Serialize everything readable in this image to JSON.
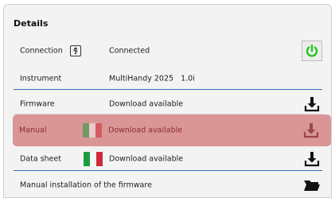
{
  "panel": {
    "title": "Details"
  },
  "connection": {
    "label": "Connection",
    "value": "Connected",
    "icon": "usb-icon",
    "action_icon": "power-icon",
    "action_color": "#22c41f"
  },
  "instrument": {
    "label": "Instrument",
    "value": "MultiHandy 2025",
    "version": "1.0i"
  },
  "firmware": {
    "label": "Firmware",
    "value": "Download available",
    "action_icon": "download-icon"
  },
  "manual": {
    "label": "Manual",
    "value": "Download available",
    "flag": "italy-flag",
    "highlight_color": "#c44848",
    "action_icon": "download-icon"
  },
  "datasheet": {
    "label": "Data sheet",
    "value": "Download available",
    "flag": "italy-flag",
    "action_icon": "download-icon"
  },
  "manual_install": {
    "label": "Manual installation of the firmware",
    "action_icon": "folder-open-icon"
  },
  "colors": {
    "flag_green": "#1e9b40",
    "flag_white": "#f7f7f7",
    "flag_red": "#ce2b37",
    "separator_blue": "#2d6fb3"
  }
}
